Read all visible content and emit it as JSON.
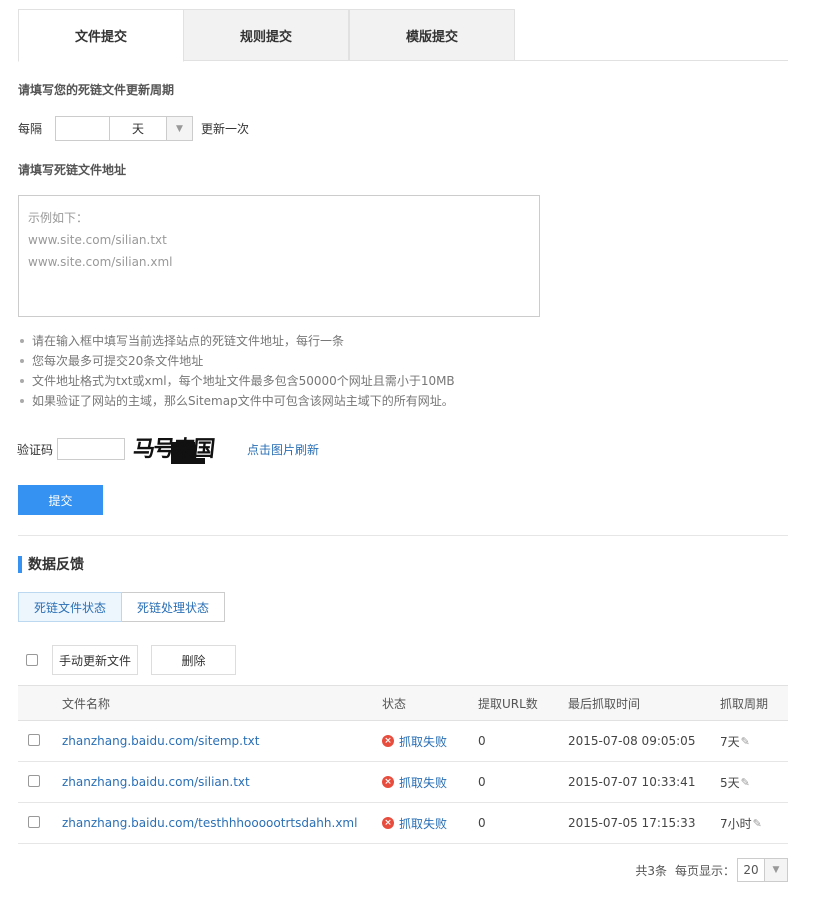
{
  "tabs": [
    {
      "label": "文件提交",
      "active": true
    },
    {
      "label": "规则提交",
      "active": false
    },
    {
      "label": "模版提交",
      "active": false
    }
  ],
  "update_cycle": {
    "title": "请填写您的死链文件更新周期",
    "prefix": "每隔",
    "value": "",
    "unit": "天",
    "suffix": "更新一次"
  },
  "file_address": {
    "title": "请填写死链文件地址",
    "placeholder_lines": [
      "示例如下：",
      "www.site.com/silian.txt",
      "www.site.com/silian.xml"
    ]
  },
  "tips": [
    "请在输入框中填写当前选择站点的死链文件地址，每行一条",
    "您每次最多可提交20条文件地址",
    "文件地址格式为txt或xml，每个地址文件最多包含50000个网址且需小于10MB",
    "如果验证了网站的主域，那么Sitemap文件中可包含该网站主域下的所有网址。"
  ],
  "captcha": {
    "label": "验证码",
    "value": "",
    "image_text": "马号来国",
    "refresh_label": "点击图片刷新"
  },
  "submit_label": "提交",
  "feedback": {
    "title": "数据反馈",
    "subtabs": [
      {
        "label": "死链文件状态",
        "active": true
      },
      {
        "label": "死链处理状态",
        "active": false
      }
    ],
    "toolbar": {
      "manual_update_label": "手动更新文件",
      "delete_label": "删除"
    },
    "table": {
      "headers": [
        "文件名称",
        "状态",
        "提取URL数",
        "最后抓取时间",
        "抓取周期"
      ],
      "rows": [
        {
          "file": "zhanzhang.baidu.com/sitemp.txt",
          "status": "抓取失败",
          "url_count": "0",
          "last_crawl": "2015-07-08 09:05:05",
          "cycle": "7天"
        },
        {
          "file": "zhanzhang.baidu.com/silian.txt",
          "status": "抓取失败",
          "url_count": "0",
          "last_crawl": "2015-07-07 10:33:41",
          "cycle": "5天"
        },
        {
          "file": "zhanzhang.baidu.com/testhhhoooootrtsdahh.xml",
          "status": "抓取失败",
          "url_count": "0",
          "last_crawl": "2015-07-05 17:15:33",
          "cycle": "7小时"
        }
      ]
    },
    "pager": {
      "total_label": "共3条",
      "per_page_label": "每页显示：",
      "per_page_value": "20"
    }
  },
  "colors": {
    "accent": "#3592f2",
    "link": "#2a6fb5",
    "error": "#e74c3c"
  }
}
